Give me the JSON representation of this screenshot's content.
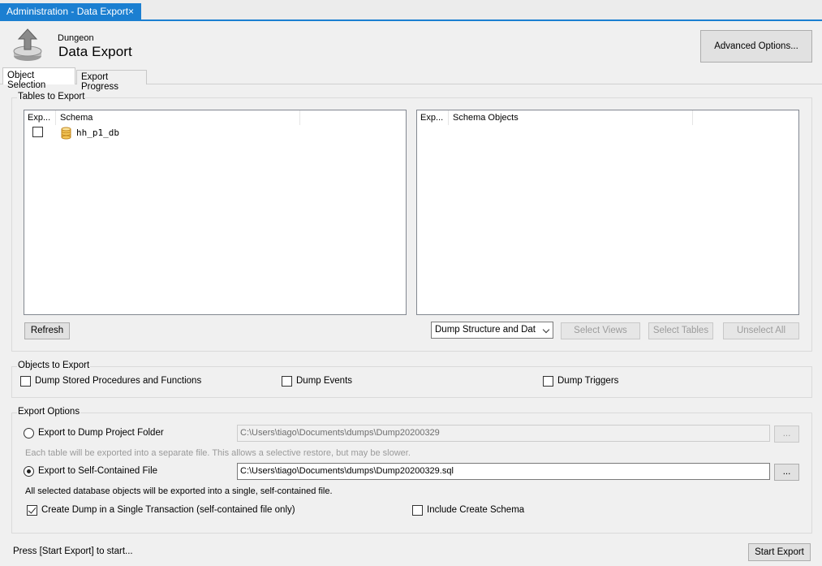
{
  "window_tab": {
    "title": "Administration - Data Export",
    "close_glyph": "×"
  },
  "header": {
    "subtitle": "Dungeon",
    "title": "Data Export",
    "icon": "export-icon",
    "advanced_button": "Advanced Options..."
  },
  "tabs": [
    {
      "label": "Object Selection",
      "active": true
    },
    {
      "label": "Export Progress",
      "active": false
    }
  ],
  "tables_to_export": {
    "title": "Tables to Export",
    "schema_list": {
      "columns": [
        "Exp...",
        "Schema"
      ],
      "rows": [
        {
          "checked": false,
          "name": "hh_p1_db",
          "icon": "database-icon"
        }
      ]
    },
    "objects_list": {
      "columns": [
        "Exp...",
        "Schema Objects"
      ],
      "rows": []
    },
    "refresh_button": "Refresh",
    "dump_mode": {
      "selected": "Dump Structure and Dat"
    },
    "select_views_button": "Select Views",
    "select_tables_button": "Select Tables",
    "unselect_all_button": "Unselect All"
  },
  "objects_to_export": {
    "title": "Objects to Export",
    "options": [
      {
        "label": "Dump Stored Procedures and Functions",
        "checked": false
      },
      {
        "label": "Dump Events",
        "checked": false
      },
      {
        "label": "Dump Triggers",
        "checked": false
      }
    ]
  },
  "export_options": {
    "title": "Export Options",
    "project_folder": {
      "label": "Export to Dump Project Folder",
      "selected": false,
      "path": "C:\\Users\\tiago\\Documents\\dumps\\Dump20200329",
      "hint": "Each table will be exported into a separate file. This allows a selective restore, but may be slower."
    },
    "self_contained": {
      "label": "Export to Self-Contained File",
      "selected": true,
      "path": "C:\\Users\\tiago\\Documents\\dumps\\Dump20200329.sql",
      "note": "All selected database objects will be exported into a single, self-contained file."
    },
    "browse_label": "...",
    "single_transaction": {
      "label": "Create Dump in a Single Transaction (self-contained file only)",
      "checked": true
    },
    "include_create_schema": {
      "label": "Include Create Schema",
      "checked": false
    }
  },
  "footer": {
    "status": "Press [Start Export] to start...",
    "start_button": "Start Export"
  },
  "colors": {
    "accent": "#1b7fd1",
    "background": "#f0f0f0",
    "db_icon": "#e8b13d"
  }
}
